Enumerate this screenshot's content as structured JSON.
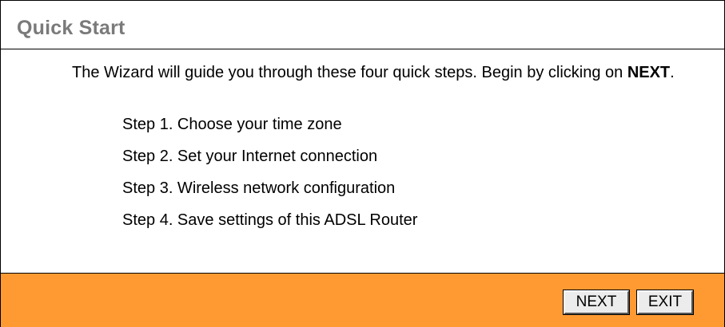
{
  "header": {
    "title": "Quick Start"
  },
  "intro": {
    "text_before": "The Wizard will guide you through these four quick steps. Begin by clicking on",
    "emphasis": "NEXT",
    "text_after": "."
  },
  "steps": [
    {
      "label": "Step 1. Choose your time zone"
    },
    {
      "label": "Step 2. Set your Internet connection"
    },
    {
      "label": "Step 3. Wireless network configuration"
    },
    {
      "label": "Step 4. Save settings of this ADSL Router"
    }
  ],
  "footer": {
    "next_label": "NEXT",
    "exit_label": "EXIT"
  },
  "colors": {
    "footer_bg": "#ff9a33",
    "title_text": "#7a7a7a"
  }
}
